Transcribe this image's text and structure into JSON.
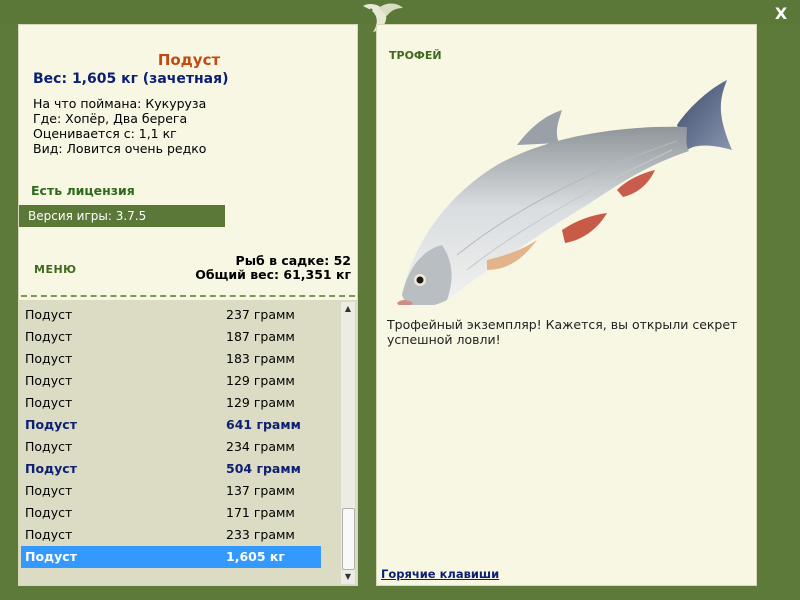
{
  "window": {
    "close_label": "X"
  },
  "fish": {
    "name": "Подуст",
    "weight": "Вес: 1,605 кг (зачетная)",
    "caught_on": "На что поймана: Кукуруза",
    "location": "Где: Хопёр, Два берега",
    "valued_from": "Оценивается с: 1,1 кг",
    "kind": "Вид: Ловится очень редко"
  },
  "license": "Есть лицензия",
  "version": "Версия игры: 3.7.5",
  "menu": {
    "title": "МЕНЮ",
    "cage_count": "Рыб в садке: 52",
    "total_weight": "Общий вес: 61,351 кг"
  },
  "catch_list": [
    {
      "name": "Подуст",
      "weight": "237 грамм",
      "style": "normal"
    },
    {
      "name": "Подуст",
      "weight": "187 грамм",
      "style": "normal"
    },
    {
      "name": "Подуст",
      "weight": "183 грамм",
      "style": "normal"
    },
    {
      "name": "Подуст",
      "weight": "129 грамм",
      "style": "normal"
    },
    {
      "name": "Подуст",
      "weight": "129 грамм",
      "style": "normal"
    },
    {
      "name": "Подуст",
      "weight": "641 грамм",
      "style": "trophy"
    },
    {
      "name": "Подуст",
      "weight": "234 грамм",
      "style": "normal"
    },
    {
      "name": "Подуст",
      "weight": "504 грамм",
      "style": "trophy"
    },
    {
      "name": "Подуст",
      "weight": "137 грамм",
      "style": "normal"
    },
    {
      "name": "Подуст",
      "weight": "171 грамм",
      "style": "normal"
    },
    {
      "name": "Подуст",
      "weight": "233 грамм",
      "style": "normal"
    },
    {
      "name": "Подуст",
      "weight": "1,605 кг",
      "style": "selected"
    }
  ],
  "trophy": {
    "label": "ТРОФЕЙ",
    "text": "Трофейный экземпляр! Кажется, вы открыли секрет успешной ловли!"
  },
  "hotkeys": "Горячие клавиши",
  "colors": {
    "frame": "#5c7838",
    "panel": "#f7f7e4",
    "title": "#c24a10",
    "weight": "#0c1f73",
    "selected": "#3399ff"
  },
  "icons": {
    "logo": "fish-logo-icon",
    "close": "close-icon"
  }
}
